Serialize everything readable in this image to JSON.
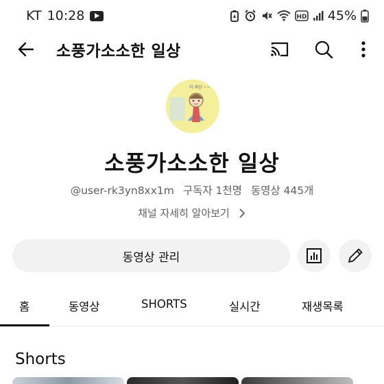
{
  "status": {
    "carrier": "KT",
    "time": "10:28",
    "battery": "45%"
  },
  "app_bar": {
    "title": "소풍가소소한 일상"
  },
  "channel": {
    "name": "소풍가소소한 일상",
    "handle": "@user-rk3yn8xx1m",
    "subscribers": "구독자 1천명",
    "videos": "동영상 445개",
    "about_link": "채널 자세히 알아보기"
  },
  "actions": {
    "manage_videos": "동영상 관리"
  },
  "tabs": [
    {
      "label": "홈",
      "selected": true
    },
    {
      "label": "동영상",
      "selected": false
    },
    {
      "label": "SHORTS",
      "selected": false
    },
    {
      "label": "실시간",
      "selected": false
    },
    {
      "label": "재생목록",
      "selected": false
    }
  ],
  "sections": {
    "shorts_title": "Shorts"
  },
  "colors": {
    "text_primary": "#0f0f0f",
    "text_secondary": "#606060",
    "chip_background": "#f2f2f2",
    "avatar_background": "#f3ef9a"
  },
  "icons": {
    "back": "arrow-left-icon",
    "cast": "cast-icon",
    "search": "search-icon",
    "more": "more-vertical-icon",
    "analytics": "analytics-icon",
    "edit": "pencil-icon",
    "chevron": "chevron-right-icon"
  }
}
